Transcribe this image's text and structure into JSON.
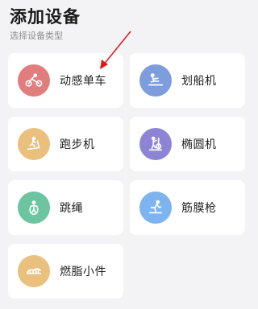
{
  "header": {
    "title": "添加设备",
    "subtitle": "选择设备类型"
  },
  "devices": [
    {
      "label": "动感单车",
      "icon": "bike-icon",
      "color": "#e27d7d"
    },
    {
      "label": "划船机",
      "icon": "rowing-machine-icon",
      "color": "#7e9ddd"
    },
    {
      "label": "跑步机",
      "icon": "treadmill-icon",
      "color": "#e9c07e"
    },
    {
      "label": "椭圆机",
      "icon": "elliptical-icon",
      "color": "#8d84d6"
    },
    {
      "label": "跳绳",
      "icon": "jump-rope-icon",
      "color": "#6cc4a0"
    },
    {
      "label": "筋膜枪",
      "icon": "massage-gun-icon",
      "color": "#7db3ef"
    },
    {
      "label": "燃脂小件",
      "icon": "fat-burning-gear-icon",
      "color": "#e9c07e"
    }
  ],
  "annotation": {
    "arrow_color": "#e01818"
  }
}
